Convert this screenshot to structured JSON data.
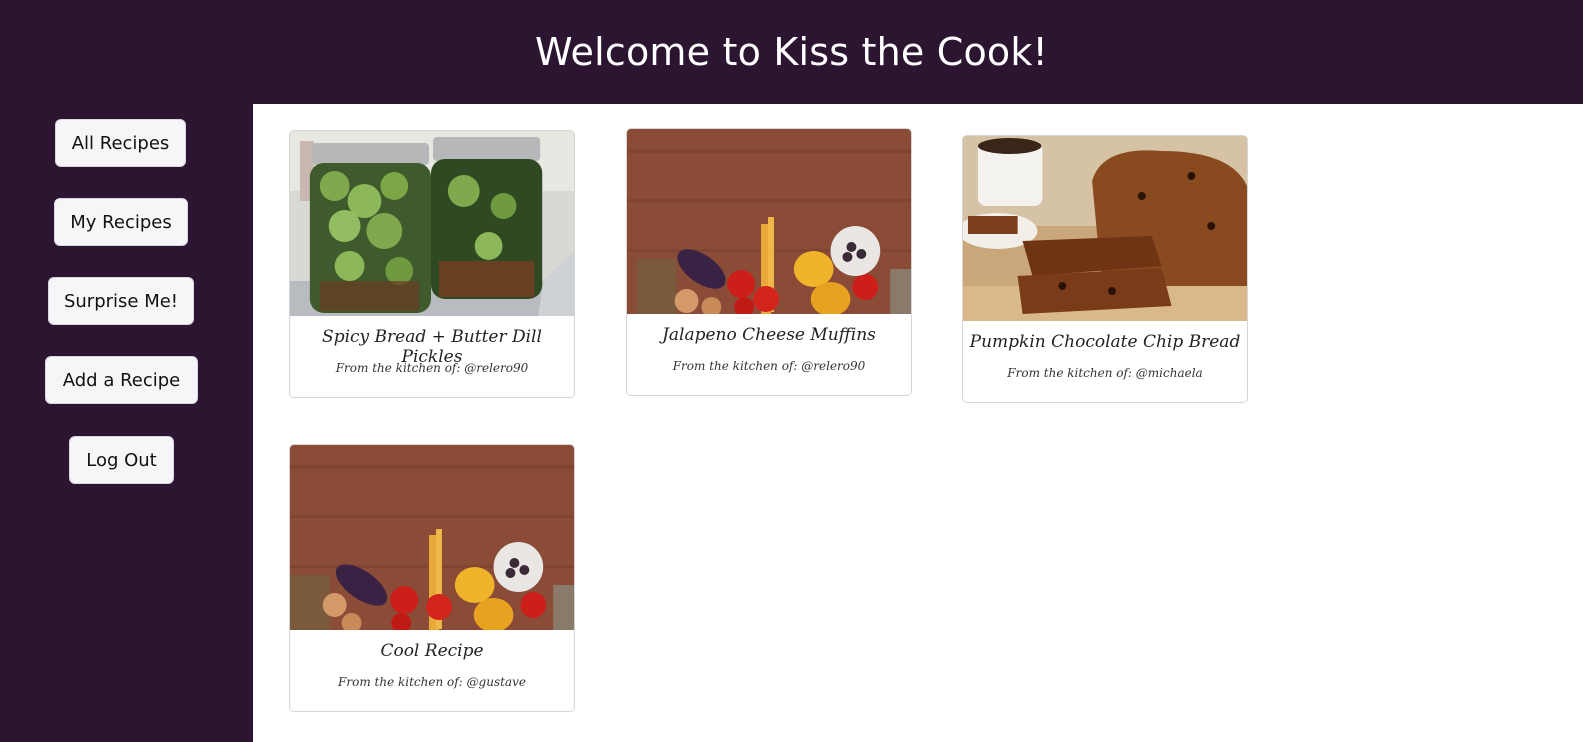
{
  "header": {
    "title": "Welcome to Kiss the Cook!"
  },
  "sidebar": {
    "buttons": [
      {
        "label": "All Recipes"
      },
      {
        "label": "My Recipes"
      },
      {
        "label": "Surprise Me!"
      },
      {
        "label": "Add a Recipe"
      },
      {
        "label": "Log Out"
      }
    ]
  },
  "recipes": [
    {
      "title": "Spicy Bread + Butter Dill Pickles",
      "author_line": "From the kitchen of: @relero90",
      "image": "pickle-jars-photo"
    },
    {
      "title": "Jalapeno Cheese Muffins",
      "author_line": "From the kitchen of: @relero90",
      "image": "vegetables-on-wood-photo"
    },
    {
      "title": "Pumpkin Chocolate Chip Bread",
      "author_line": "From the kitchen of: @michaela",
      "image": "pumpkin-bread-photo"
    },
    {
      "title": "Cool Recipe",
      "author_line": "From the kitchen of: @gustave",
      "image": "vegetables-on-wood-photo"
    }
  ],
  "colors": {
    "background": "#2c1530",
    "button": "#f6f6f9",
    "content": "#ffffff"
  }
}
